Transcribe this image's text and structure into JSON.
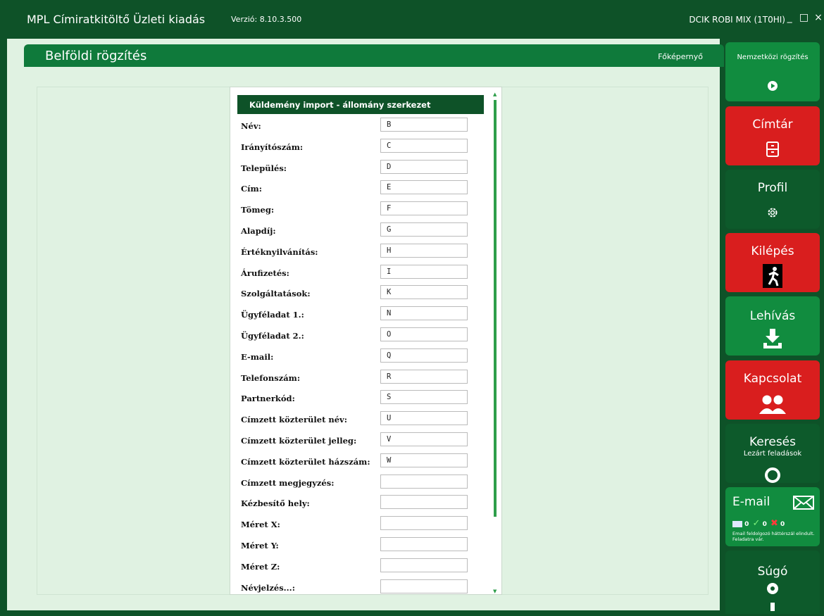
{
  "titlebar": {
    "app_title": "MPL Címiratkitöltő Üzleti kiadás",
    "version": "Verzió: 8.10.3.500",
    "user": "DCIK ROBI MIX (1T0HI)",
    "minimize": "_",
    "maximize": "□",
    "close": "×"
  },
  "header": {
    "title": "Belföldi rögzítés",
    "home_link": "Főképernyő"
  },
  "form": {
    "title": "Küldemény import - állomány szerkezet",
    "fields": [
      {
        "label": "Név:",
        "value": "B"
      },
      {
        "label": "Irányítószám:",
        "value": "C"
      },
      {
        "label": "Település:",
        "value": "D"
      },
      {
        "label": "Cím:",
        "value": "E"
      },
      {
        "label": "Tömeg:",
        "value": "F"
      },
      {
        "label": "Alapdíj:",
        "value": "G"
      },
      {
        "label": "Értéknyilvánítás:",
        "value": "H"
      },
      {
        "label": "Árufizetés:",
        "value": "I"
      },
      {
        "label": "Szolgáltatások:",
        "value": "K"
      },
      {
        "label": "Ügyféladat 1.:",
        "value": "N"
      },
      {
        "label": "Ügyféladat 2.:",
        "value": "O"
      },
      {
        "label": "E-mail:",
        "value": "Q"
      },
      {
        "label": "Telefonszám:",
        "value": "R"
      },
      {
        "label": "Partnerkód:",
        "value": "S"
      },
      {
        "label": "Címzett közterület név:",
        "value": "U"
      },
      {
        "label": "Címzett közterület jelleg:",
        "value": "V"
      },
      {
        "label": "Címzett közterület házszám:",
        "value": "W"
      },
      {
        "label": "Címzett megjegyzés:",
        "value": ""
      },
      {
        "label": "Kézbesítő hely:",
        "value": ""
      },
      {
        "label": "Méret X:",
        "value": ""
      },
      {
        "label": "Méret Y:",
        "value": ""
      },
      {
        "label": "Méret Z:",
        "value": ""
      },
      {
        "label": "Névjelzés...:",
        "value": ""
      }
    ]
  },
  "sidebar": {
    "international": "Nemzetközi rögzítés",
    "directory": "Címtár",
    "profile": "Profil",
    "exit": "Kilépés",
    "download": "Lehívás",
    "contact": "Kapcsolat",
    "search": "Keresés",
    "search_sub": "Lezárt feladások",
    "email": "E-mail",
    "email_counts": [
      "0",
      "0",
      "0"
    ],
    "email_status": "Email feldolgozó háttérszál elindult. Feladatra vár.",
    "help": "Súgó"
  },
  "colors": {
    "dark_green": "#0e5228",
    "green": "#118c3f",
    "red": "#d91e1e",
    "bg_light": "#e0f2e2"
  }
}
